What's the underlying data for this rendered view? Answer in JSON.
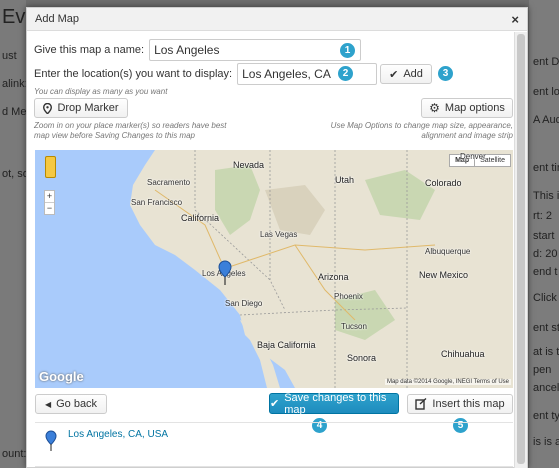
{
  "background": {
    "title_fragment": "Eve",
    "left_fragments": [
      "ust",
      "alink:",
      "d Me",
      "ot, so",
      "ount:"
    ],
    "right_fragments": [
      "ent Do",
      "ent loc",
      "A Aud",
      "ent tin",
      "This is",
      "rt:  2",
      "start",
      "d:  20",
      "end t",
      "Click h",
      "ent sta",
      "at is t",
      "pen",
      "ancel",
      "ent typ",
      "is is a"
    ]
  },
  "modal": {
    "title": "Add Map",
    "close_symbol": "×",
    "name_label": "Give this map a name:",
    "name_value": "Los Angeles",
    "location_label": "Enter the location(s) you want to display:",
    "location_value": "Los Angeles, CA",
    "add_button": "Add",
    "add_icon": "check-icon",
    "hint_multiple": "You can display as many as you want",
    "drop_marker_button": "Drop Marker",
    "drop_marker_icon": "map-pin-icon",
    "map_options_button": "Map options",
    "map_options_icon": "gear-icon",
    "hint_zoom": "Zoom in on your place marker(s) so readers have best map view before Saving Changes to this map",
    "hint_options": "Use Map Options to change map size, appearance, alignment and image strip",
    "badges": [
      "1",
      "2",
      "3",
      "4",
      "5"
    ],
    "go_back_button": "Go back",
    "save_button": "Save changes to this map",
    "insert_button": "Insert this map",
    "result_link": "Los Angeles, CA, USA"
  },
  "map": {
    "type_map": "Map",
    "type_satellite": "Satellite",
    "zoom_in": "+",
    "zoom_out": "−",
    "logo": "Google",
    "attribution": "Map data ©2014 Google, INEGI   Terms of Use",
    "labels": {
      "sacramento": "Sacramento",
      "san_francisco": "San Francisco",
      "california": "California",
      "nevada": "Nevada",
      "las_vegas": "Las Vegas",
      "utah": "Utah",
      "colorado": "Colorado",
      "los_angeles": "Los Angeles",
      "san_diego": "San Diego",
      "arizona": "Arizona",
      "phoenix": "Phoenix",
      "new_mexico": "New Mexico",
      "albuquerque": "Albuquerque",
      "tucson": "Tucson",
      "baja_california": "Baja California",
      "sonora": "Sonora",
      "chihuahua": "Chihuahua",
      "denver": "Denver"
    },
    "colors": {
      "ocean": "#a9cbfb",
      "land": "#e8e3d3",
      "mountain": "#c9d7b2",
      "marker": "#3b7fd9"
    }
  }
}
